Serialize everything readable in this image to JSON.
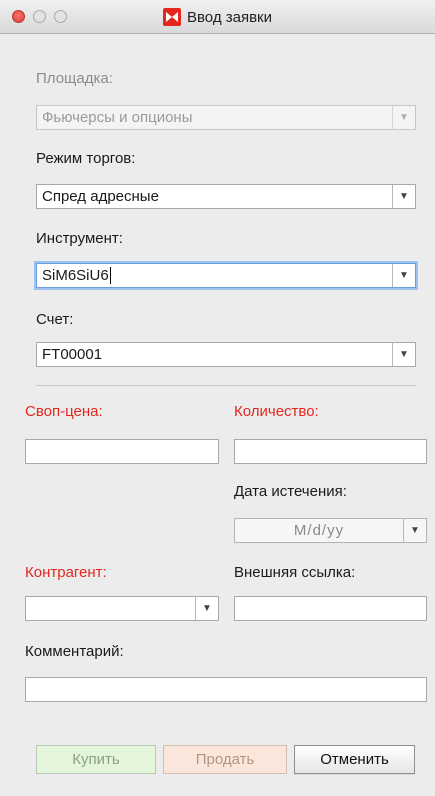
{
  "window": {
    "title": "Ввод заявки",
    "logo_color": "#e5261f"
  },
  "form": {
    "venue": {
      "label": "Площадка:",
      "value": "Фьючерсы и опционы"
    },
    "trade_mode": {
      "label": "Режим торгов:",
      "value": "Спред адресные"
    },
    "instrument": {
      "label": "Инструмент:",
      "value": "SiM6SiU6"
    },
    "account": {
      "label": "Счет:",
      "value": "FT00001"
    },
    "swap_price": {
      "label": "Своп-цена:",
      "value": ""
    },
    "quantity": {
      "label": "Количество:",
      "value": ""
    },
    "expiry_date": {
      "label": "Дата истечения:",
      "placeholder": "M/d/yy"
    },
    "counterparty": {
      "label": "Контрагент:",
      "value": ""
    },
    "external_ref": {
      "label": "Внешняя ссылка:",
      "value": ""
    },
    "comment": {
      "label": "Комментарий:",
      "value": ""
    }
  },
  "buttons": {
    "buy": "Купить",
    "sell": "Продать",
    "cancel": "Отменить"
  },
  "colors": {
    "required_label": "#e5261f",
    "buy_bg": "#e3f6dc",
    "sell_bg": "#fbe6db",
    "focus_ring": "#9cc2f0"
  }
}
